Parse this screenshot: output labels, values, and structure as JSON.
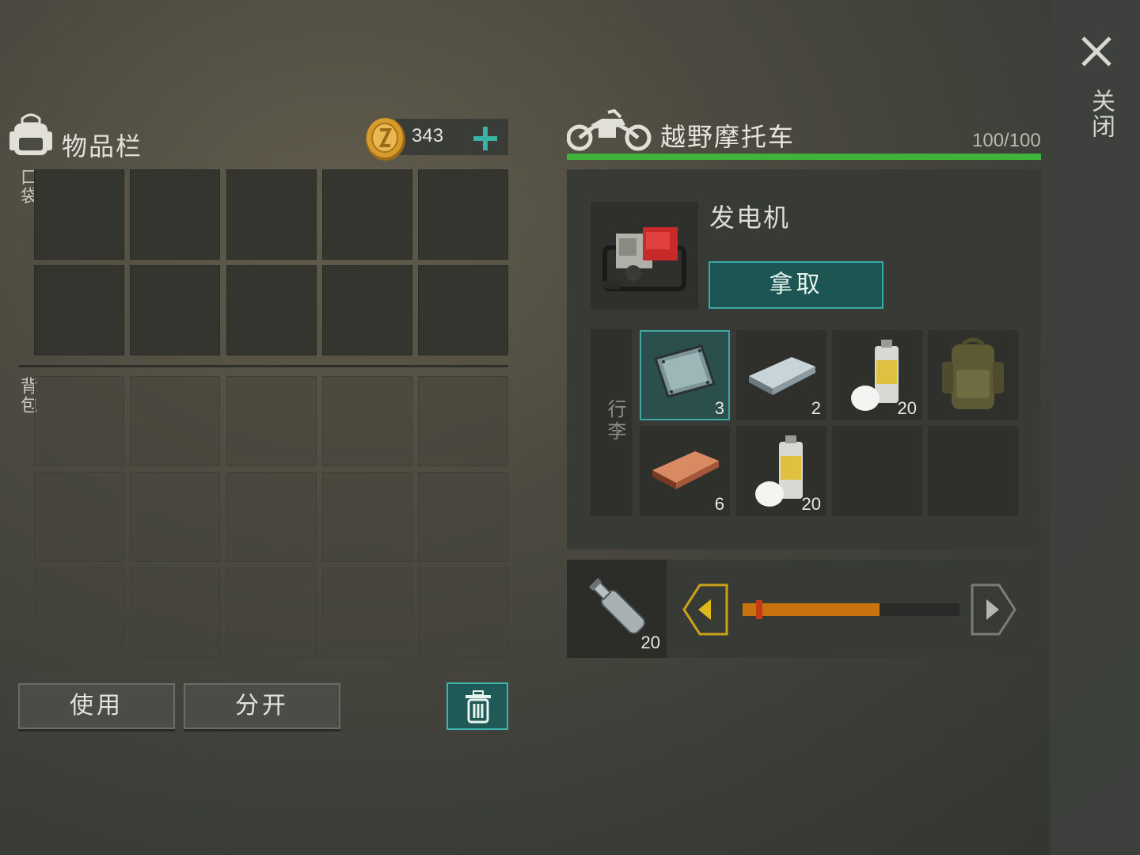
{
  "inventory": {
    "title": "物品栏",
    "coins": "343",
    "pocket_label": "口袋",
    "backpack_label": "背包",
    "use_button": "使用",
    "split_button": "分开"
  },
  "vehicle": {
    "title": "越野摩托车",
    "durability": "100/100",
    "durability_fraction": 1.0,
    "selected_item": "发电机",
    "take_button": "拿取",
    "trunk_label": "行李",
    "trunk_items": [
      {
        "name": "metal-sheet",
        "qty": "3",
        "selected": true
      },
      {
        "name": "steel-ingot",
        "qty": "2"
      },
      {
        "name": "spray-paint",
        "qty": "20"
      },
      {
        "name": "military-backpack",
        "qty": ""
      },
      {
        "name": "copper-ingot",
        "qty": "6"
      },
      {
        "name": "spray-paint",
        "qty": "20"
      },
      {
        "name": "empty",
        "qty": ""
      },
      {
        "name": "empty",
        "qty": ""
      }
    ],
    "transfer": {
      "item": "plastic-bottle",
      "qty": "20",
      "slider_fraction": 0.63
    }
  },
  "close_label": "关闭",
  "colors": {
    "accent_teal": "#38a9a3",
    "health_green": "#3fb43a",
    "slider_orange": "#c8720f",
    "arrow_yellow": "#c9a21a"
  }
}
